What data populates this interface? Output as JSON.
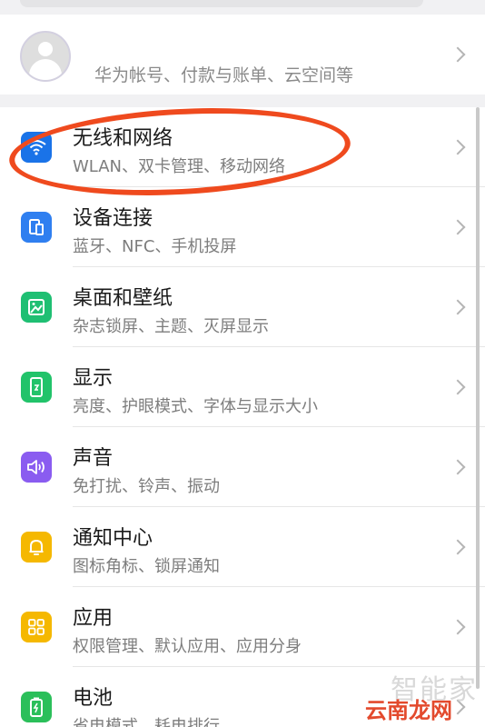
{
  "account": {
    "name": "",
    "subtitle": "华为帐号、付款与账单、云空间等"
  },
  "settings": [
    {
      "title": "无线和网络",
      "subtitle": "WLAN、双卡管理、移动网络",
      "icon": "wifi-icon",
      "color": "#1a73e8"
    },
    {
      "title": "设备连接",
      "subtitle": "蓝牙、NFC、手机投屏",
      "icon": "device-connection-icon",
      "color": "#2f7ff0"
    },
    {
      "title": "桌面和壁纸",
      "subtitle": "杂志锁屏、主题、灭屏显示",
      "icon": "wallpaper-icon",
      "color": "#1fbf73"
    },
    {
      "title": "显示",
      "subtitle": "亮度、护眼模式、字体与显示大小",
      "icon": "display-icon",
      "color": "#22c36a"
    },
    {
      "title": "声音",
      "subtitle": "免打扰、铃声、振动",
      "icon": "sound-icon",
      "color": "#8a5cf0"
    },
    {
      "title": "通知中心",
      "subtitle": "图标角标、锁屏通知",
      "icon": "bell-icon",
      "color": "#f5b800"
    },
    {
      "title": "应用",
      "subtitle": "权限管理、默认应用、应用分身",
      "icon": "apps-grid-icon",
      "color": "#f5b800"
    },
    {
      "title": "电池",
      "subtitle": "省电模式、耗电排行",
      "icon": "battery-icon",
      "color": "#2bbf5a"
    }
  ],
  "watermark": {
    "text_a": "智能家",
    "text_b": "云南龙网"
  }
}
